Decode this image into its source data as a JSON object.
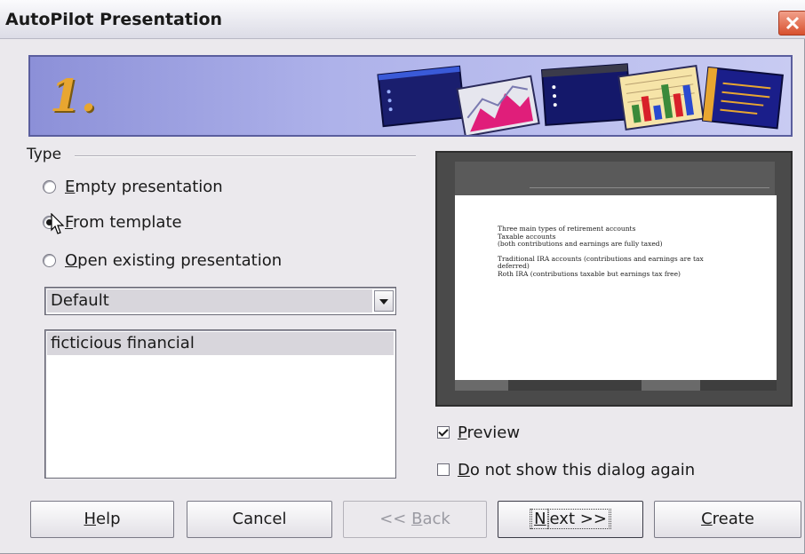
{
  "window": {
    "title": "AutoPilot Presentation"
  },
  "banner": {
    "step": "1."
  },
  "type_section": {
    "label": "Type",
    "options": [
      {
        "label_ul": "E",
        "label_rest": "mpty presentation",
        "checked": false
      },
      {
        "label_ul": "F",
        "label_rest": "rom template",
        "checked": true
      },
      {
        "label_ul": "O",
        "label_rest": "pen existing presentation",
        "checked": false
      }
    ]
  },
  "template_category": {
    "selected": "Default"
  },
  "template_list": {
    "items": [
      "ficticious financial"
    ]
  },
  "preview": {
    "lines_a": [
      "Three main types of retirement accounts",
      "Taxable accounts",
      "(both contributions and earnings are fully taxed)"
    ],
    "lines_b": [
      "Traditional IRA accounts (contributions and earnings are tax",
      "deferred)",
      "Roth IRA (contributions taxable but earnings tax free)"
    ]
  },
  "checkboxes": {
    "preview": {
      "label_ul": "P",
      "label_rest": "review",
      "checked": true
    },
    "no_show": {
      "label_ul": "D",
      "label_rest": "o not show this dialog again",
      "checked": false
    }
  },
  "buttons": {
    "help": {
      "ul": "H",
      "rest": "elp"
    },
    "cancel": {
      "label": "Cancel"
    },
    "back": {
      "pre": "<< ",
      "ul": "B",
      "rest": "ack"
    },
    "next": {
      "ul": "N",
      "rest": "ext >>"
    },
    "create": {
      "ul": "C",
      "rest": "reate"
    }
  },
  "colors": {
    "accent": "#8c90d8",
    "step": "#e8a630",
    "close": "#d8502e"
  }
}
